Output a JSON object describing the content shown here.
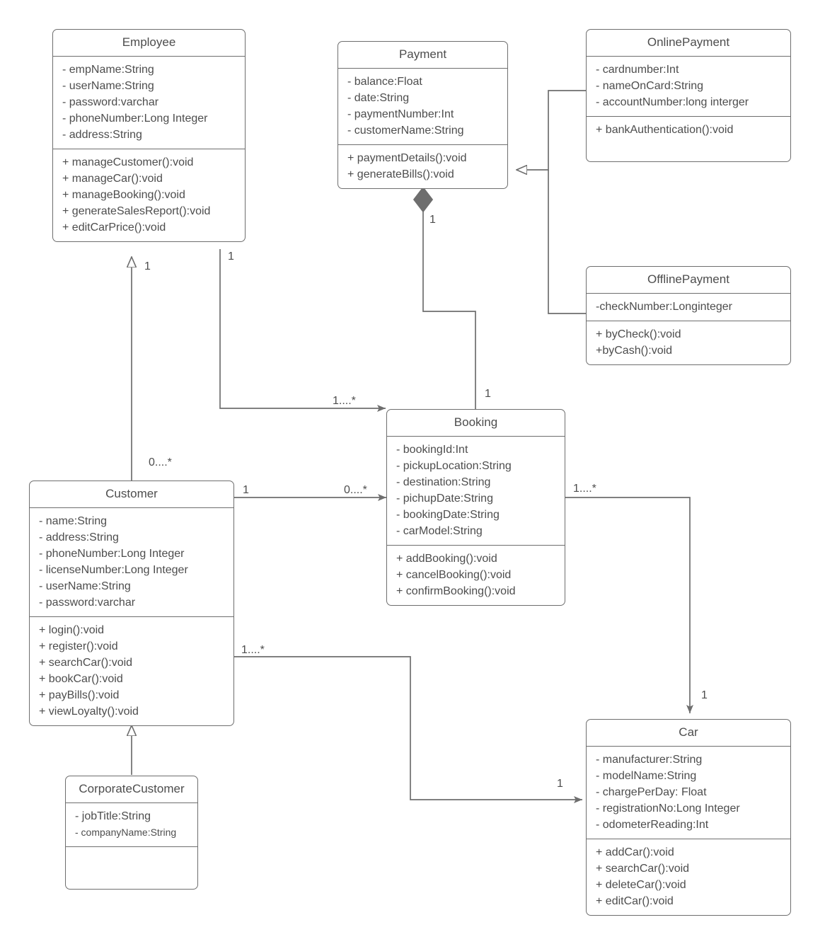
{
  "diagram": {
    "kind": "uml-class-diagram",
    "colors": {
      "stroke": "#6e6e6e",
      "text": "#4d4d4d",
      "fill": "#ffffff",
      "solid_marker": "#6e6e6e"
    }
  },
  "classes": {
    "employee": {
      "name": "Employee",
      "attributes": [
        "- empName:String",
        "- userName:String",
        "- password:varchar",
        "- phoneNumber:Long Integer",
        "- address:String"
      ],
      "operations": [
        "+ manageCustomer():void",
        "+ manageCar():void",
        "+ manageBooking():void",
        "+ generateSalesReport():void",
        "+ editCarPrice():void"
      ]
    },
    "payment": {
      "name": "Payment",
      "attributes": [
        "- balance:Float",
        "- date:String",
        "- paymentNumber:Int",
        "- customerName:String"
      ],
      "operations": [
        "+ paymentDetails():void",
        "+ generateBills():void"
      ]
    },
    "online_payment": {
      "name": "OnlinePayment",
      "attributes": [
        "- cardnumber:Int",
        "- nameOnCard:String",
        "- accountNumber:long interger"
      ],
      "operations": [
        "+ bankAuthentication():void"
      ]
    },
    "offline_payment": {
      "name": "OfflinePayment",
      "attributes": [
        "-checkNumber:Longinteger"
      ],
      "operations": [
        "+ byCheck():void",
        "+byCash():void"
      ]
    },
    "booking": {
      "name": "Booking",
      "attributes": [
        "- bookingId:Int",
        "- pickupLocation:String",
        "- destination:String",
        "- pichupDate:String",
        "- bookingDate:String",
        "- carModel:String"
      ],
      "operations": [
        "+ addBooking():void",
        "+ cancelBooking():void",
        "+ confirmBooking():void"
      ]
    },
    "customer": {
      "name": "Customer",
      "attributes": [
        "- name:String",
        "- address:String",
        "- phoneNumber:Long Integer",
        "- licenseNumber:Long Integer",
        "- userName:String",
        "- password:varchar"
      ],
      "operations": [
        "+ login():void",
        "+ register():void",
        "+ searchCar():void",
        "+ bookCar():void",
        "+ payBills():void",
        "+ viewLoyalty():void"
      ]
    },
    "corporate_customer": {
      "name": "CorporateCustomer",
      "attributes": [
        "-  jobTitle:String",
        "-  companyName:String"
      ],
      "operations": []
    },
    "car": {
      "name": "Car",
      "attributes": [
        "- manufacturer:String",
        "- modelName:String",
        "- chargePerDay: Float",
        "- registrationNo:Long Integer",
        "- odometerReading:Int"
      ],
      "operations": [
        "+ addCar():void",
        "+ searchCar():void",
        "+ deleteCar():void",
        "+ editCar():void"
      ]
    }
  },
  "multiplicities": {
    "customer_generalization": "1",
    "employee_booking_source": "1",
    "employee_booking_target": "1....*",
    "payment_booking": "1",
    "booking_payment": "1",
    "customer_above": "0....*",
    "customer_booking_source": "1",
    "customer_booking_target": "0....*",
    "booking_car_source": "1....*",
    "booking_car_target": "1",
    "customer_car_source": "1....*",
    "customer_car_target": "1"
  }
}
